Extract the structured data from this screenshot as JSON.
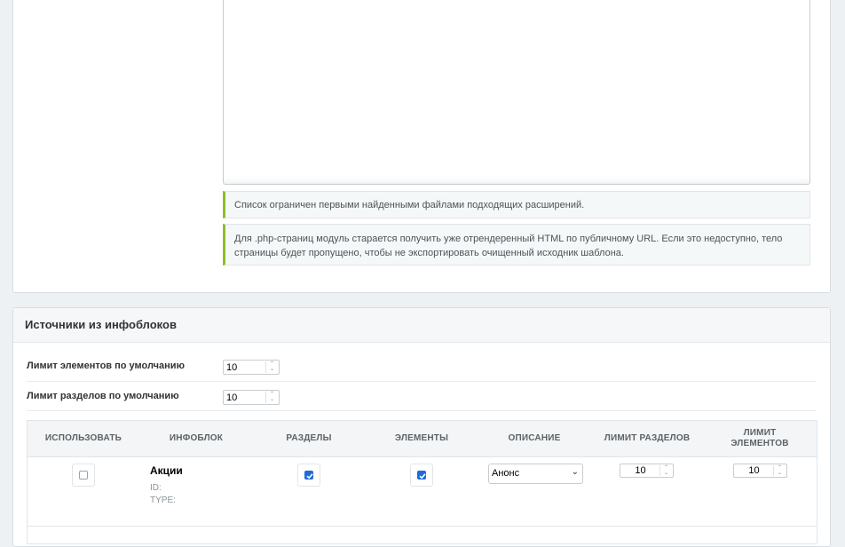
{
  "notes": {
    "limit_note": "Список ограничен первыми найденными файлами подходящих расширений.",
    "php_note": "Для .php-страниц модуль старается получить уже отрендеренный HTML по публичному URL. Если это недоступно, тело страницы будет пропущено, чтобы не экспортировать очищенный исходник шаблона."
  },
  "sources": {
    "title": "Источники из инфоблоков",
    "default_elements_limit_label": "Лимит элементов по умолчанию",
    "default_elements_limit_value": "10",
    "default_sections_limit_label": "Лимит разделов по умолчанию",
    "default_sections_limit_value": "10",
    "table": {
      "headers": {
        "use": "ИСПОЛЬЗОВАТЬ",
        "iblock": "ИНФОБЛОК",
        "sections": "РАЗДЕЛЫ",
        "elements": "ЭЛЕМЕНТЫ",
        "description": "ОПИСАНИЕ",
        "sections_limit": "ЛИМИТ РАЗДЕЛОВ",
        "elements_limit_line1": "ЛИМИТ",
        "elements_limit_line2": "ЭЛЕМЕНТОВ"
      },
      "rows": [
        {
          "use_checked": false,
          "name": "Акции",
          "id_label": "ID:",
          "type_label": "TYPE:",
          "sections_checked": true,
          "elements_checked": true,
          "description": "Анонс",
          "sections_limit": "10",
          "elements_limit": "10"
        }
      ]
    }
  },
  "colors": {
    "accent": "#8cbf26",
    "checkbox": "#1f6cd6"
  }
}
